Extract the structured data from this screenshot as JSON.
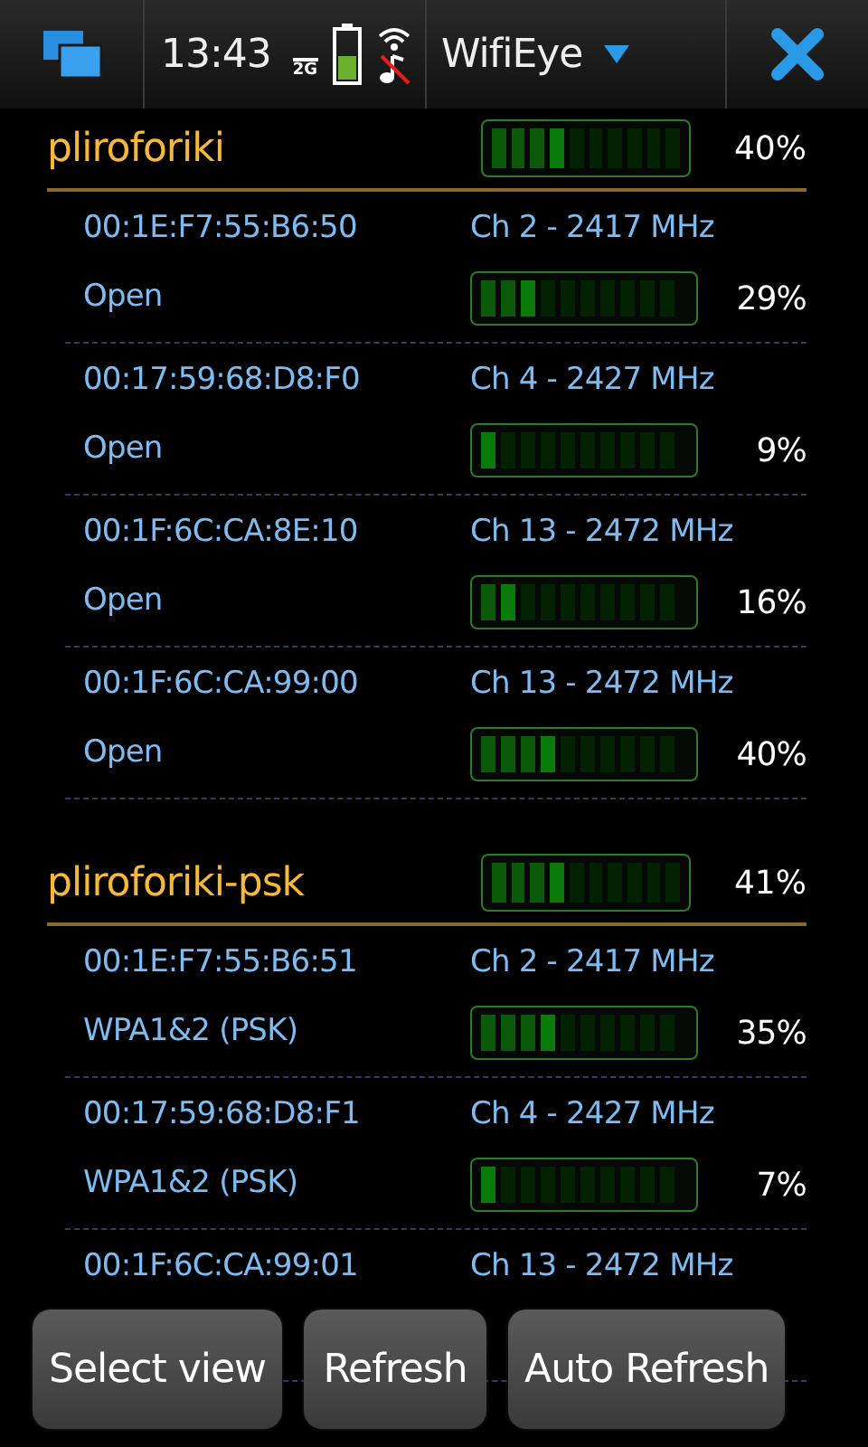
{
  "status_bar": {
    "time": "13:43",
    "network": "2G",
    "app_title": "WifiEye"
  },
  "networks": [
    {
      "ssid": "pliroforiki",
      "level": 0.4,
      "percent": "40%",
      "access_points": [
        {
          "mac": "00:1E:F7:55:B6:50",
          "channel": "Ch 2 - 2417 MHz",
          "security": "Open",
          "level": 0.29,
          "percent": "29%"
        },
        {
          "mac": "00:17:59:68:D8:F0",
          "channel": "Ch 4 - 2427 MHz",
          "security": "Open",
          "level": 0.09,
          "percent": "9%"
        },
        {
          "mac": "00:1F:6C:CA:8E:10",
          "channel": "Ch 13 - 2472 MHz",
          "security": "Open",
          "level": 0.16,
          "percent": "16%"
        },
        {
          "mac": "00:1F:6C:CA:99:00",
          "channel": "Ch 13 - 2472 MHz",
          "security": "Open",
          "level": 0.4,
          "percent": "40%"
        }
      ]
    },
    {
      "ssid": "pliroforiki-psk",
      "level": 0.41,
      "percent": "41%",
      "access_points": [
        {
          "mac": "00:1E:F7:55:B6:51",
          "channel": "Ch 2 - 2417 MHz",
          "security": "WPA1&2 (PSK)",
          "level": 0.35,
          "percent": "35%"
        },
        {
          "mac": "00:17:59:68:D8:F1",
          "channel": "Ch 4 - 2427 MHz",
          "security": "WPA1&2 (PSK)",
          "level": 0.07,
          "percent": "7%"
        },
        {
          "mac": "00:1F:6C:CA:99:01",
          "channel": "Ch 13 - 2472 MHz"
        }
      ]
    }
  ],
  "buttons": [
    {
      "label": "Select view"
    },
    {
      "label": "Refresh"
    },
    {
      "label": "Auto Refresh"
    }
  ]
}
